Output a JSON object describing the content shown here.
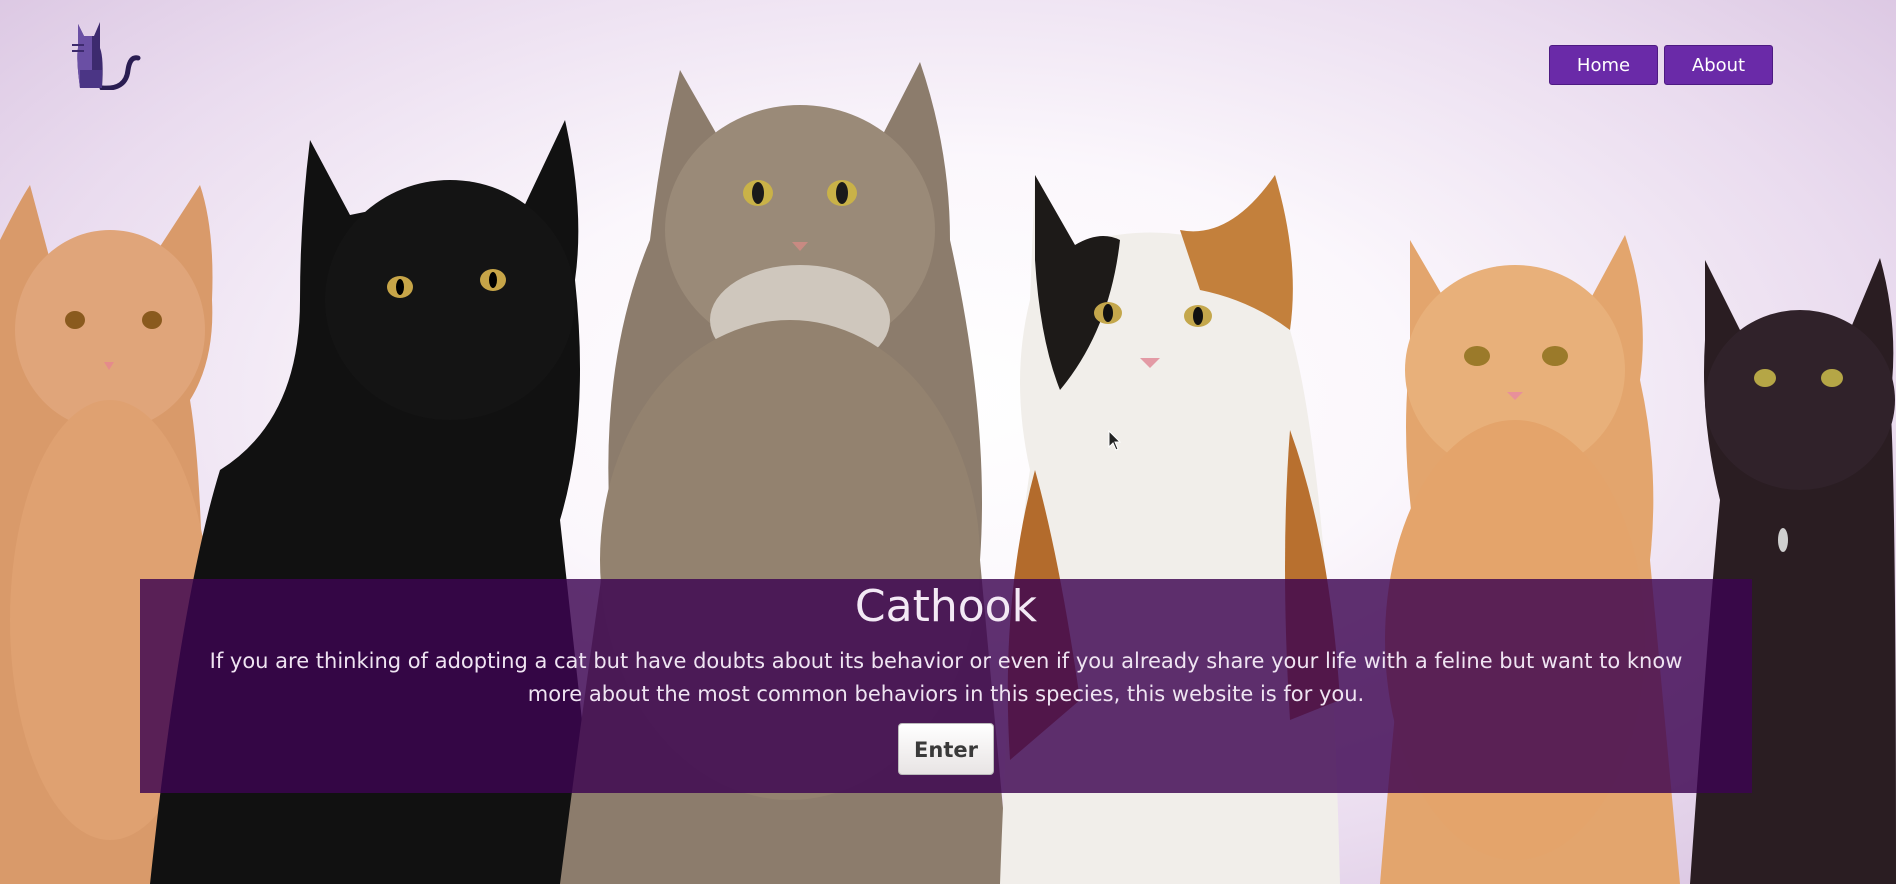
{
  "header": {
    "logo_icon": "cat-silhouette-icon",
    "nav": [
      {
        "label": "Home"
      },
      {
        "label": "About"
      }
    ]
  },
  "hero": {
    "title": "Cathook",
    "text": "If you are thinking of adopting a cat but have doubts about its behavior or even if you already share your life with a feline but want to know more about the most common behaviors in this species, this website is for you.",
    "button_label": "Enter"
  },
  "colors": {
    "accent": "#6a2aa8",
    "hero_overlay": "#3c0450",
    "background_tint": "#d7c1df"
  }
}
